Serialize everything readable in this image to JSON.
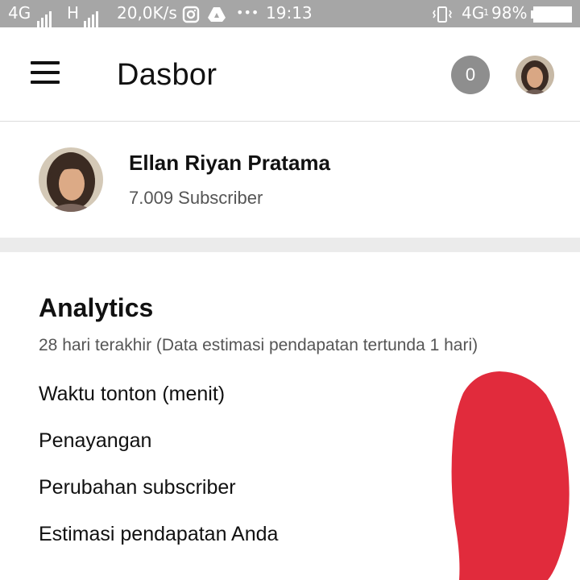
{
  "status_bar": {
    "network1": "4G",
    "network2": "H",
    "speed": "20,0K/s",
    "dots": "•••",
    "time": "19:13",
    "network3": "4G",
    "battery": "98%"
  },
  "app_bar": {
    "title": "Dasbor",
    "notification_count": "0"
  },
  "profile": {
    "name": "Ellan Riyan Pratama",
    "subscribers": "7.009 Subscriber"
  },
  "analytics": {
    "title": "Analytics",
    "subtitle": "28 hari terakhir (Data estimasi pendapatan tertunda 1 hari)",
    "metrics": [
      {
        "label": "Waktu tonton (menit)"
      },
      {
        "label": "Penayangan"
      },
      {
        "label": "Perubahan subscriber"
      },
      {
        "label": "Estimasi pendapatan Anda"
      }
    ]
  },
  "colors": {
    "status_bar": "#a6a6a6",
    "badge": "#8e8e8e",
    "redaction": "#e12b3c",
    "separator": "#ebebeb"
  }
}
